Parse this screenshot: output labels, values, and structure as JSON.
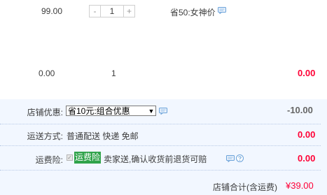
{
  "item1": {
    "unit_price": "99.00",
    "quantity": "1",
    "minus_label": "-",
    "plus_label": "+",
    "promotion": "省50:女神价"
  },
  "item2": {
    "unit_price": "0.00",
    "quantity": "1",
    "subtotal": "0.00"
  },
  "shop_discount": {
    "label": "店铺优惠:",
    "selected_option": "省10元:组合优惠",
    "amount": "-10.00"
  },
  "shipping": {
    "label": "运送方式:",
    "method": "普通配送 快递 免邮",
    "price": "0.00"
  },
  "shipping_insurance": {
    "label": "运费险:",
    "badge": "运费险",
    "description": "卖家送,确认收货前退货可赔",
    "price": "0.00",
    "checked": true
  },
  "shop_total": {
    "label": "店铺合计(含运费)",
    "value": "¥39.00"
  },
  "colors": {
    "price_red": "#ff0036",
    "summary_bg": "#f2f7ff",
    "badge_green": "#30a34a",
    "icon_blue": "#6aa2da"
  },
  "icons": {
    "chat": "chat-bubble-icon",
    "help": "question-icon",
    "dropdown": "triangle-down-icon"
  }
}
